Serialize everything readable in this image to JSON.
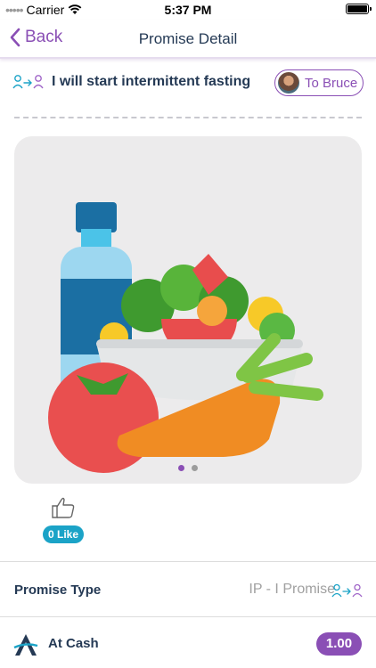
{
  "status_bar": {
    "carrier": "Carrier",
    "time": "5:37 PM"
  },
  "nav": {
    "back_label": "Back",
    "title": "Promise Detail"
  },
  "promise": {
    "text": "I will start intermittent fasting",
    "recipient_label": "To Bruce"
  },
  "image": {
    "page_count": 2,
    "active_page": 1
  },
  "likes": {
    "label": "0 Like"
  },
  "promise_type": {
    "label": "Promise Type",
    "value": "IP - I Promise"
  },
  "cash": {
    "label": "At Cash",
    "amount": "1.00"
  },
  "colors": {
    "accent": "#8a4fb5",
    "teal": "#1ba3c7",
    "navy": "#253a55"
  }
}
